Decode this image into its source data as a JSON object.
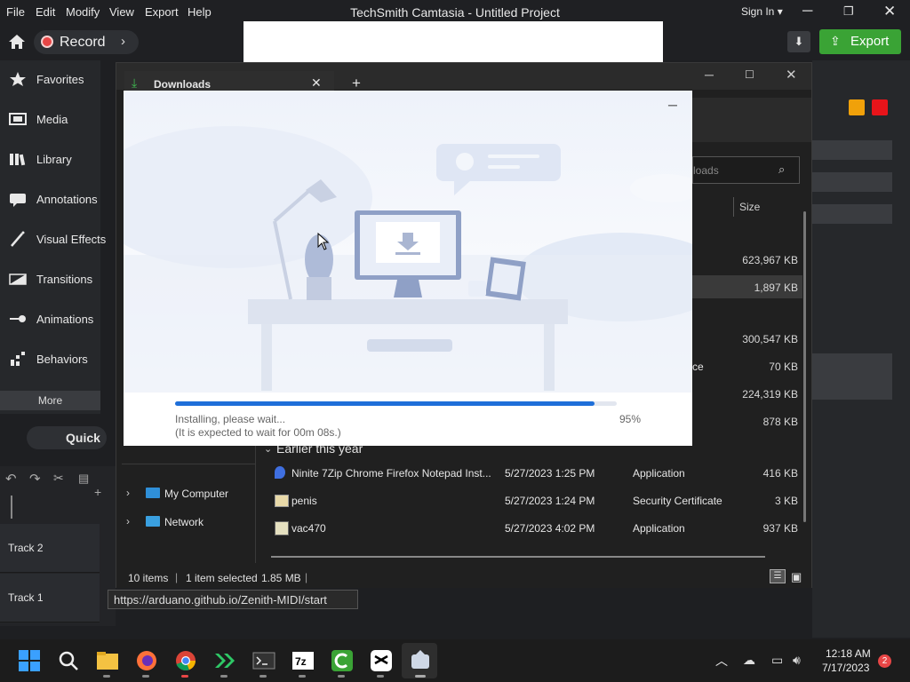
{
  "app": {
    "title": "TechSmith Camtasia - Untitled Project",
    "menu": [
      "File",
      "Edit",
      "Modify",
      "View",
      "Export",
      "Help"
    ],
    "sign_in": "Sign In",
    "record_label": "Record",
    "export_label": "Export",
    "quick_label": "Quick",
    "more_label": "More",
    "sidebar": [
      {
        "label": "Favorites",
        "icon": "star-icon"
      },
      {
        "label": "Media",
        "icon": "film-icon"
      },
      {
        "label": "Library",
        "icon": "library-icon"
      },
      {
        "label": "Annotations",
        "icon": "annotation-icon"
      },
      {
        "label": "Visual Effects",
        "icon": "wand-icon"
      },
      {
        "label": "Transitions",
        "icon": "transition-icon"
      },
      {
        "label": "Animations",
        "icon": "animation-icon"
      },
      {
        "label": "Behaviors",
        "icon": "behavior-icon"
      }
    ],
    "tracks": [
      "Track 2",
      "Track 1"
    ],
    "colors": {
      "accent_green": "#3aa335",
      "record_red": "#e84646"
    }
  },
  "explorer": {
    "tab_label": "Downloads",
    "search_placeholder": "loads",
    "size_header": "Size",
    "sizes_top": [
      "623,967 KB",
      "1,897 KB",
      "300,547 KB",
      "70 KB",
      "224,319 KB",
      "878 KB"
    ],
    "type_fragment": "ce",
    "group_label": "Earlier this year",
    "rows": [
      {
        "name": "Ninite 7Zip Chrome Firefox Notepad Inst...",
        "date": "5/27/2023 1:25 PM",
        "type": "Application",
        "size": "416 KB"
      },
      {
        "name": "penis",
        "date": "5/27/2023 1:24 PM",
        "type": "Security Certificate",
        "size": "3 KB"
      },
      {
        "name": "vac470",
        "date": "5/27/2023 4:02 PM",
        "type": "Application",
        "size": "937 KB"
      }
    ],
    "nav": [
      "My Computer",
      "Network"
    ],
    "status": {
      "items": "10 items",
      "selected": "1 item selected",
      "size": "1.85 MB"
    },
    "url": "https://arduano.github.io/Zenith-MIDI/start"
  },
  "installer": {
    "status_text": "Installing, please wait...",
    "wait_text": "(It is expected to wait for 00m 08s.)",
    "percent_label": "95%",
    "progress": 0.95
  },
  "taskbar": {
    "time": "12:18 AM",
    "date": "7/17/2023",
    "badge": "2",
    "apps": [
      "windows-start-icon",
      "search-icon",
      "file-explorer-icon",
      "firefox-icon",
      "chrome-icon",
      "winget-icon",
      "terminal-icon",
      "7zip-icon",
      "camtasia-icon",
      "capcut-icon",
      "app-icon"
    ]
  }
}
